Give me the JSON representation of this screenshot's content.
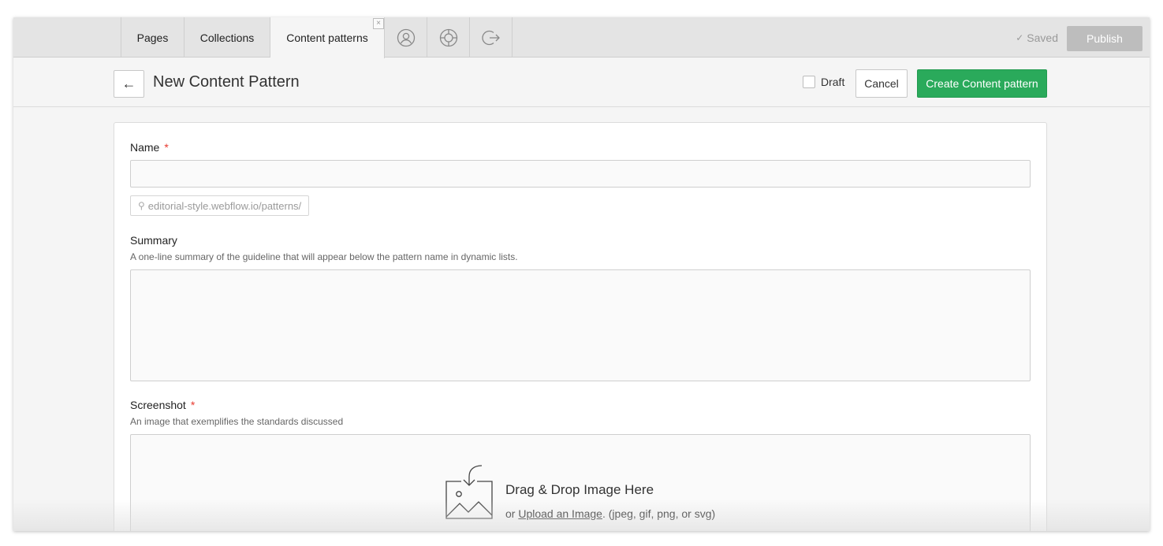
{
  "nav": {
    "tabs": [
      {
        "label": "Pages"
      },
      {
        "label": "Collections"
      },
      {
        "label": "Content patterns"
      }
    ],
    "close_label": "×",
    "icon_tabs": [
      "user-icon",
      "help-icon",
      "logout-icon"
    ],
    "saved_check": "✓",
    "saved_label": "Saved",
    "publish_label": "Publish"
  },
  "header": {
    "back_arrow": "←",
    "title": "New Content Pattern",
    "draft_label": "Draft",
    "draft_checked": false,
    "cancel_label": "Cancel",
    "create_label": "Create Content pattern"
  },
  "form": {
    "name": {
      "label": "Name",
      "required_mark": "*",
      "value": "",
      "slug_icon": "⚲",
      "slug": "editorial-style.webflow.io/patterns/"
    },
    "summary": {
      "label": "Summary",
      "hint": "A one-line summary of the guideline that will appear below the pattern name in dynamic lists.",
      "value": ""
    },
    "screenshot": {
      "label": "Screenshot",
      "required_mark": "*",
      "hint": "An image that exemplifies the standards discussed",
      "drop_title": "Drag & Drop Image Here",
      "or_text": "or",
      "upload_link": "Upload an Image",
      "formats": ". (jpeg, gif, png, or svg)"
    }
  },
  "colors": {
    "primary_green": "#2aaa5b",
    "publish_disabled": "#bdbdbd",
    "required_red": "#e8392f"
  }
}
